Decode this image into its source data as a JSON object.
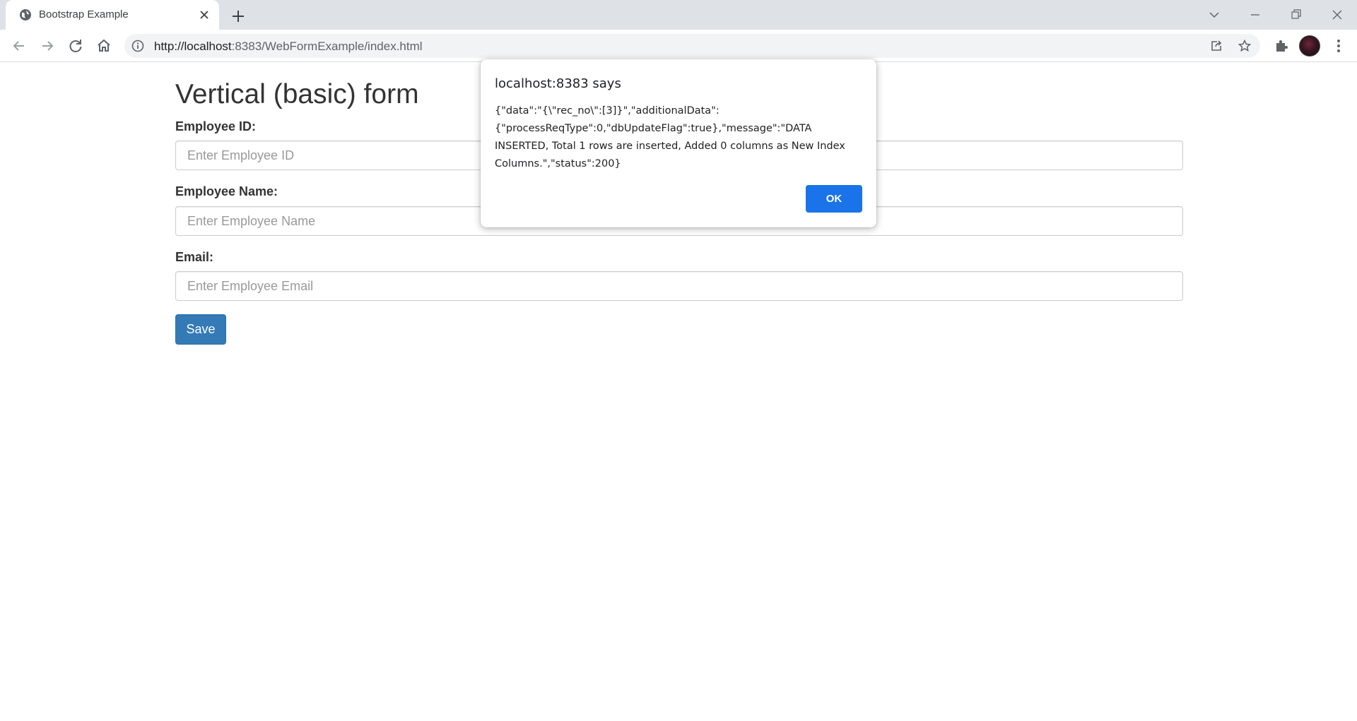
{
  "browser": {
    "tab_title": "Bootstrap Example",
    "url_host": "http://localhost",
    "url_rest": ":8383/WebFormExample/index.html"
  },
  "page": {
    "title": "Vertical (basic) form",
    "fields": [
      {
        "label": "Employee ID:",
        "placeholder": "Enter Employee ID"
      },
      {
        "label": "Employee Name:",
        "placeholder": "Enter Employee Name"
      },
      {
        "label": "Email:",
        "placeholder": "Enter Employee Email"
      }
    ],
    "save_label": "Save"
  },
  "dialog": {
    "title": "localhost:8383 says",
    "message": "{\"data\":\"{\\\"rec_no\\\":[3]}\",\"additionalData\":{\"processReqType\":0,\"dbUpdateFlag\":true},\"message\":\"DATA INSERTED, Total 1 rows are inserted, Added 0 columns as New Index Columns.\",\"status\":200}",
    "ok_label": "OK"
  },
  "colors": {
    "primary_button": "#337ab7",
    "dialog_ok": "#1a73e8",
    "tabstrip": "#dee1e6"
  }
}
